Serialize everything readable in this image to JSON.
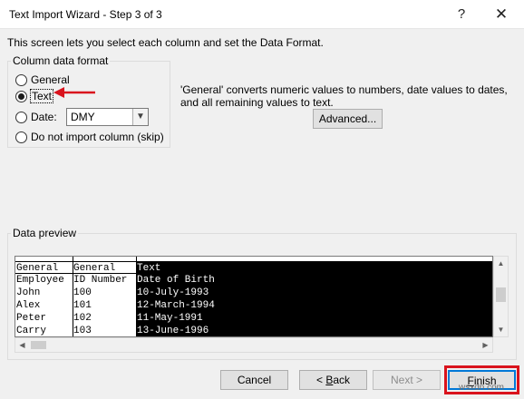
{
  "window": {
    "title": "Text Import Wizard - Step 3 of 3",
    "help_glyph": "?",
    "close_glyph": "✕"
  },
  "intro_text": "This screen lets you select each column and set the Data Format.",
  "column_format": {
    "legend": "Column data format",
    "options": [
      {
        "label": "General",
        "checked": false
      },
      {
        "label": "Text",
        "checked": true
      },
      {
        "label": "Date:",
        "checked": false
      },
      {
        "label": "Do not import column (skip)",
        "checked": false
      }
    ],
    "date_order": "DMY"
  },
  "description": "'General' converts numeric values to numbers, date values to dates, and all remaining values to text.",
  "advanced_button": "Advanced...",
  "preview": {
    "legend": "Data preview",
    "headers": [
      "General",
      "General",
      "Text"
    ],
    "rows": [
      [
        "Employee",
        "ID Number",
        "Date of Birth"
      ],
      [
        "John",
        "100",
        "10-July-1993"
      ],
      [
        "Alex",
        "101",
        "12-March-1994"
      ],
      [
        "Peter",
        "102",
        "11-May-1991"
      ],
      [
        "Carry",
        "103",
        "13-June-1996"
      ]
    ]
  },
  "buttons": {
    "cancel": "Cancel",
    "back_prefix": "< ",
    "back_key": "B",
    "back_rest": "ack",
    "next_prefix": "Next",
    "next_rest": " >",
    "finish_key": "F",
    "finish_rest": "inish"
  },
  "watermark": "wsxdn.com",
  "colors": {
    "annotation": "#d9131d",
    "selection": "#000000"
  }
}
